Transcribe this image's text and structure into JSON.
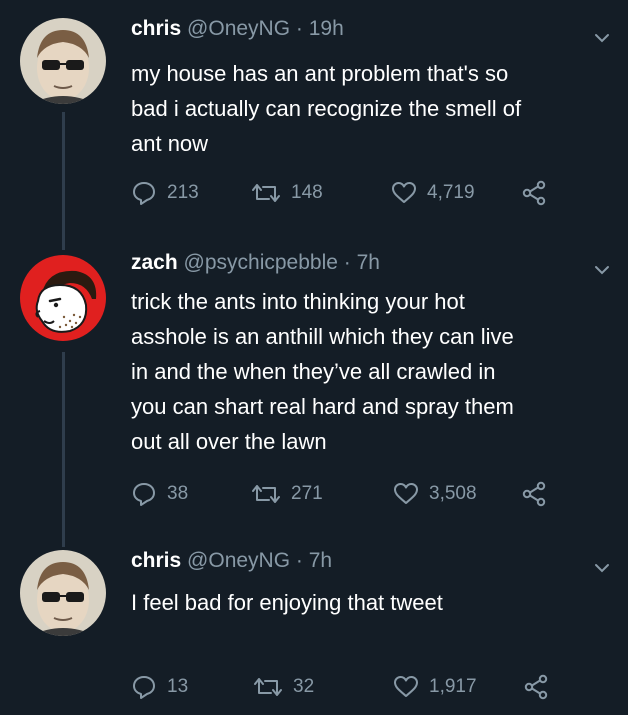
{
  "tweets": [
    {
      "name": "chris",
      "handle": "@OneyNG",
      "separator": "·",
      "time": "19h",
      "text_lines": [
        "my house has an ant problem that's so",
        "bad i actually can recognize the smell of",
        "ant now"
      ],
      "replies": "213",
      "retweets": "148",
      "likes": "4,719"
    },
    {
      "name": "zach",
      "handle": "@psychicpebble",
      "separator": "·",
      "time": "7h",
      "text_lines": [
        "trick the ants into thinking your hot",
        "asshole is an anthill which they can live",
        "in and the when they’ve all crawled in",
        "you can shart real hard and spray them",
        "out all over the lawn"
      ],
      "replies": "38",
      "retweets": "271",
      "likes": "3,508"
    },
    {
      "name": "chris",
      "handle": "@OneyNG",
      "separator": "·",
      "time": "7h",
      "text_lines": [
        "I feel bad for enjoying that tweet"
      ],
      "replies": "13",
      "retweets": "32",
      "likes": "1,917"
    }
  ],
  "icons": {
    "reply": "reply-icon",
    "retweet": "retweet-icon",
    "like": "heart-icon",
    "share": "share-icon",
    "caret": "chevron-down-icon"
  },
  "colors": {
    "background": "#141d26",
    "secondary_text": "#8899a6",
    "thread_line": "#2f3d4c",
    "zach_avatar_red": "#e0201f"
  }
}
